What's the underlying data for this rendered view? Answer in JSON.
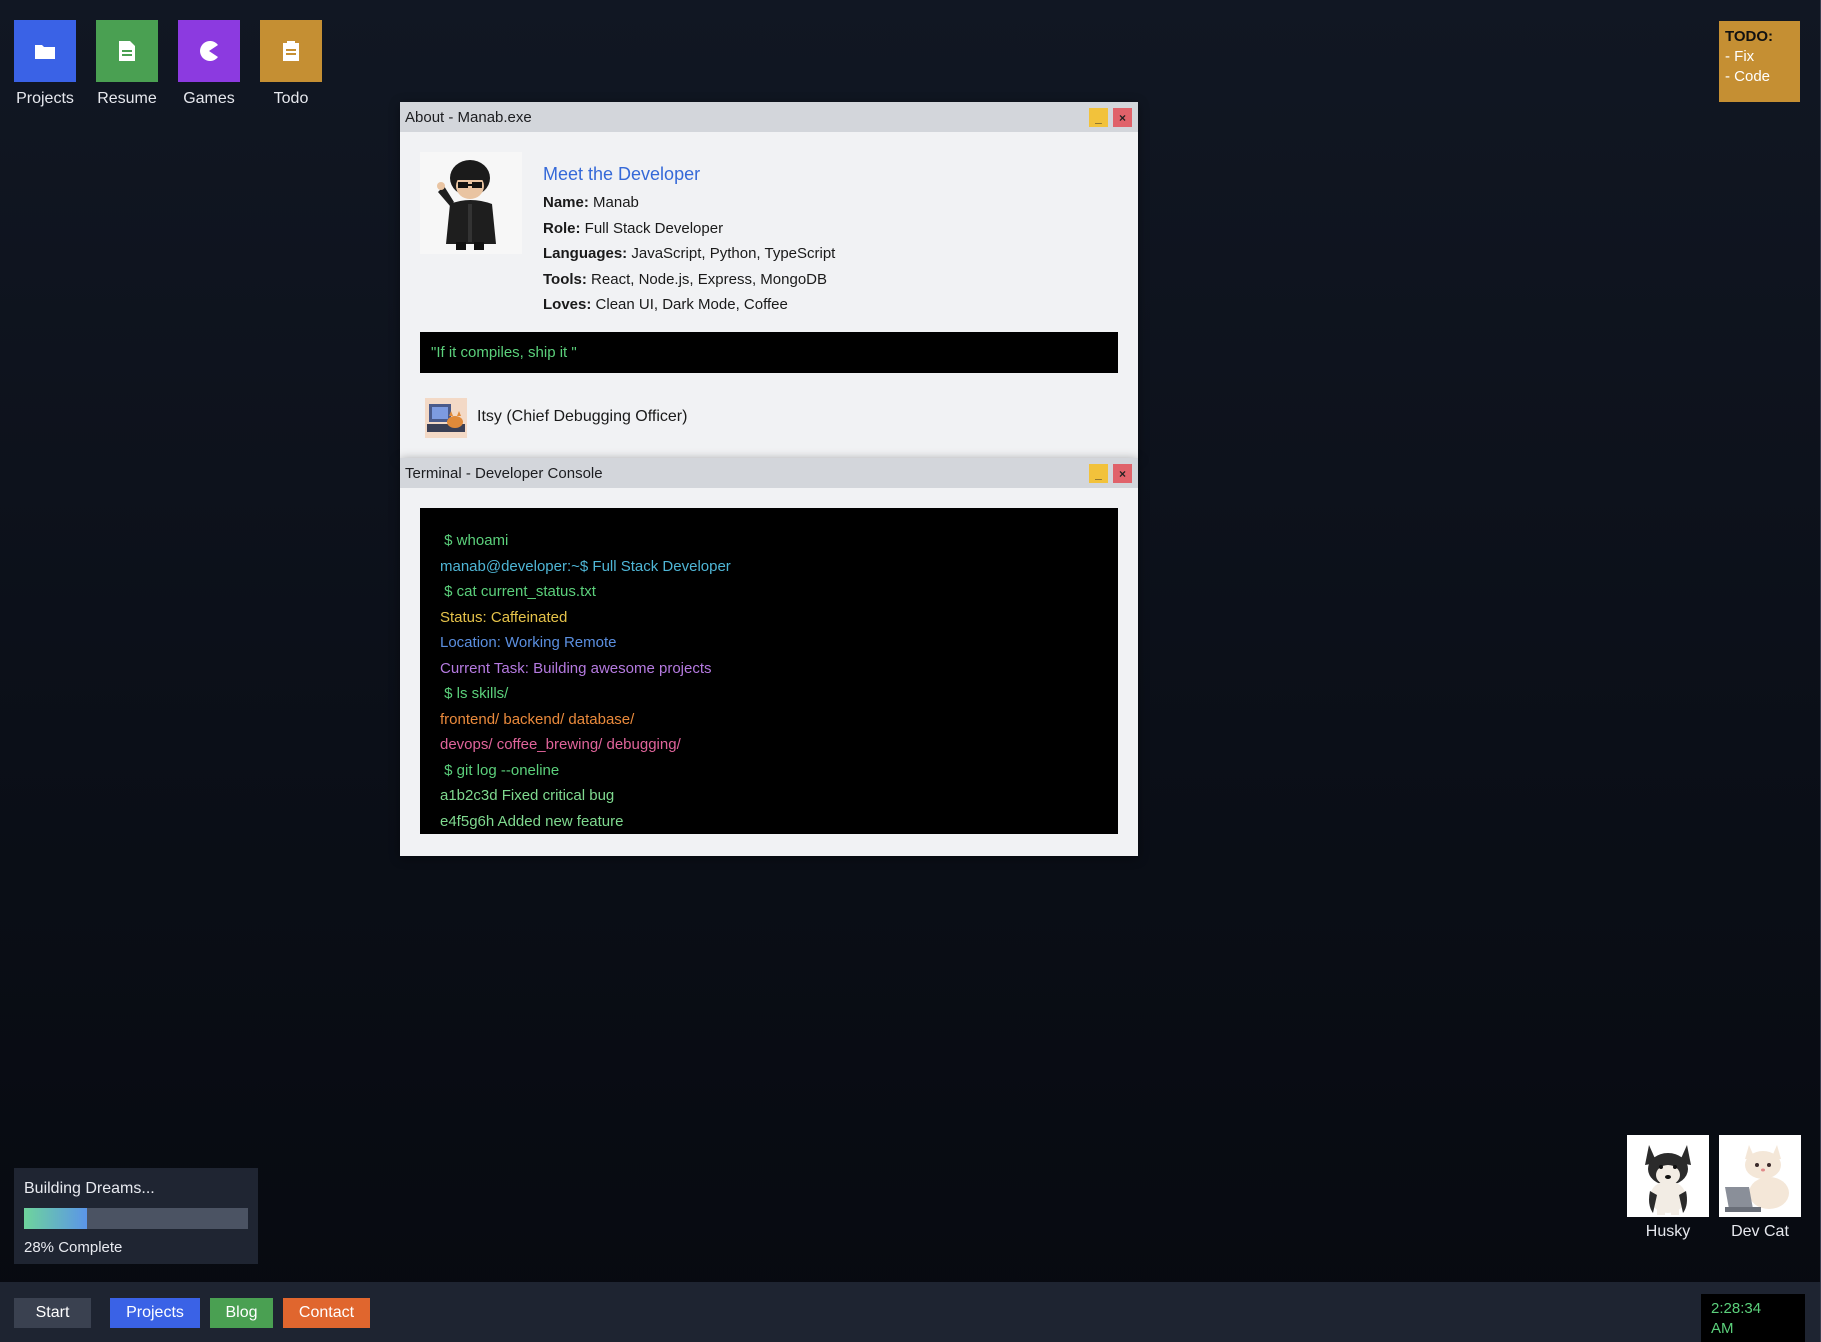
{
  "desktop_icons": [
    {
      "label": "Projects",
      "icon": "folder-icon",
      "color": "#3a62e6"
    },
    {
      "label": "Resume",
      "icon": "document-icon",
      "color": "#4aa052"
    },
    {
      "label": "Games",
      "icon": "pacman-icon",
      "color": "#8c3ae0"
    },
    {
      "label": "Todo",
      "icon": "clipboard-icon",
      "color": "#c58f33"
    }
  ],
  "sticky": {
    "heading": "TODO:",
    "line1": "- Fix",
    "line2": "- Code"
  },
  "about_window": {
    "title": "About - Manab.exe",
    "minimize_label": "_",
    "close_label": "×",
    "heading": "Meet the Developer",
    "facts": [
      {
        "key": "Name:",
        "value": " Manab"
      },
      {
        "key": "Role:",
        "value": " Full Stack Developer"
      },
      {
        "key": "Languages:",
        "value": " JavaScript, Python, TypeScript"
      },
      {
        "key": "Tools:",
        "value": " React, Node.js, Express, MongoDB"
      },
      {
        "key": "Loves:",
        "value": " Clean UI, Dark Mode, Coffee"
      }
    ],
    "quote": "\"If it compiles, ship it \"",
    "pet_label": "Itsy (Chief Debugging Officer)"
  },
  "terminal_window": {
    "title": "Terminal - Developer Console",
    "minimize_label": "_",
    "close_label": "×",
    "lines": [
      {
        "text": " $ whoami",
        "color": "#5bd07b"
      },
      {
        "text": "manab@developer:~$ Full Stack Developer",
        "color": "#4fb6d6"
      },
      {
        "text": " $ cat current_status.txt",
        "color": "#5bd07b"
      },
      {
        "text": "Status: Caffeinated",
        "color": "#e6c34a"
      },
      {
        "text": "Location: Working Remote",
        "color": "#5b8fe0"
      },
      {
        "text": "Current Task: Building awesome projects",
        "color": "#b57ae0"
      },
      {
        "text": " $ ls skills/",
        "color": "#5bd07b"
      },
      {
        "text": "frontend/ backend/ database/",
        "color": "#ea8a3c"
      },
      {
        "text": "devops/ coffee_brewing/ debugging/",
        "color": "#e0649a"
      },
      {
        "text": " $ git log --oneline",
        "color": "#5bd07b"
      },
      {
        "text": "a1b2c3d Fixed critical bug",
        "color": "#7fd98f"
      },
      {
        "text": "e4f5g6h Added new feature",
        "color": "#7fd98f"
      }
    ]
  },
  "progress": {
    "title": "Building Dreams...",
    "percent": 28,
    "label": "28% Complete"
  },
  "pets": [
    {
      "label": "Husky"
    },
    {
      "label": "Dev Cat"
    }
  ],
  "taskbar": {
    "start": "Start",
    "buttons": [
      {
        "label": "Projects",
        "color": "#3a62e6"
      },
      {
        "label": "Blog",
        "color": "#4aa052"
      },
      {
        "label": "Contact",
        "color": "#e0662e"
      }
    ],
    "clock_time": "2:28:34",
    "clock_ampm": "AM"
  }
}
